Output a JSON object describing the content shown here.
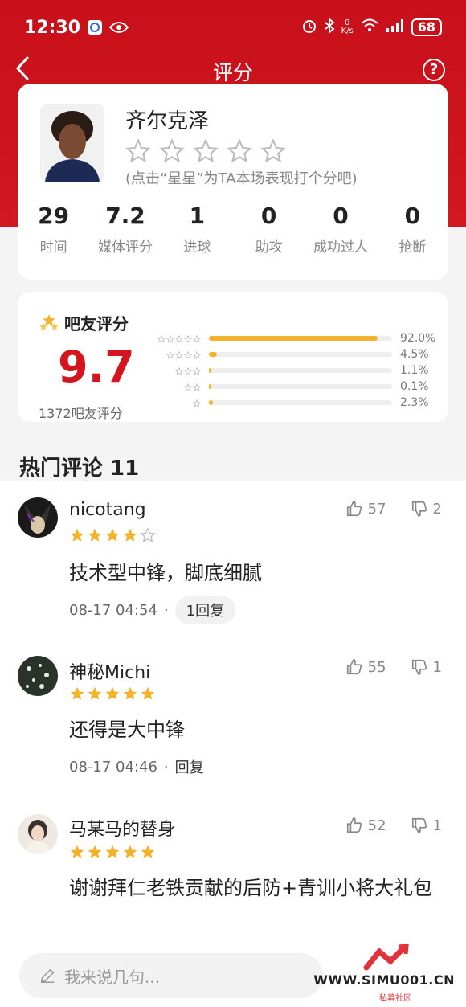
{
  "status": {
    "time": "12:30",
    "net_speed_value": "0",
    "net_speed_unit": "K/s",
    "battery": "68"
  },
  "header": {
    "title": "评分",
    "help_glyph": "?"
  },
  "player": {
    "name": "齐尔克泽",
    "rate_hint": "(点击“星星”为TA本场表现打个分吧)",
    "stats": [
      {
        "value": "29",
        "label": "时间"
      },
      {
        "value": "7.2",
        "label": "媒体评分"
      },
      {
        "value": "1",
        "label": "进球"
      },
      {
        "value": "0",
        "label": "助攻"
      },
      {
        "value": "0",
        "label": "成功过人"
      },
      {
        "value": "0",
        "label": "抢断"
      }
    ]
  },
  "fan_rating": {
    "title": "吧友评分",
    "score": "9.7",
    "count_text": "1372吧友评分",
    "distribution": [
      {
        "stars": 5,
        "pct": "92.0%",
        "fraction": 0.92
      },
      {
        "stars": 4,
        "pct": "4.5%",
        "fraction": 0.045
      },
      {
        "stars": 3,
        "pct": "1.1%",
        "fraction": 0.011
      },
      {
        "stars": 2,
        "pct": "0.1%",
        "fraction": 0.001
      },
      {
        "stars": 1,
        "pct": "2.3%",
        "fraction": 0.023
      }
    ]
  },
  "comments_section": {
    "title": "热门评论 11"
  },
  "comments": [
    {
      "user": "nicotang",
      "stars": 4,
      "text": "技术型中锋，脚底细腻",
      "time": "08-17 04:54",
      "reply": "1回复",
      "likes": "57",
      "dislikes": "2"
    },
    {
      "user": "神秘Michi",
      "stars": 5,
      "text": "还得是大中锋",
      "time": "08-17 04:46",
      "reply": "回复",
      "likes": "55",
      "dislikes": "1"
    },
    {
      "user": "马某马的替身",
      "stars": 5,
      "text": "谢谢拜仁老铁贡献的后防+青训小将大礼包",
      "time": "",
      "reply": "",
      "likes": "52",
      "dislikes": "1"
    }
  ],
  "composer": {
    "placeholder": "我来说几句..."
  },
  "watermark": {
    "url": "WWW.SIMU001.CN",
    "tag": "私募社区"
  },
  "colors": {
    "brand_red": "#d11820",
    "star_gold": "#f2b22c",
    "score_red": "#d4141f"
  }
}
